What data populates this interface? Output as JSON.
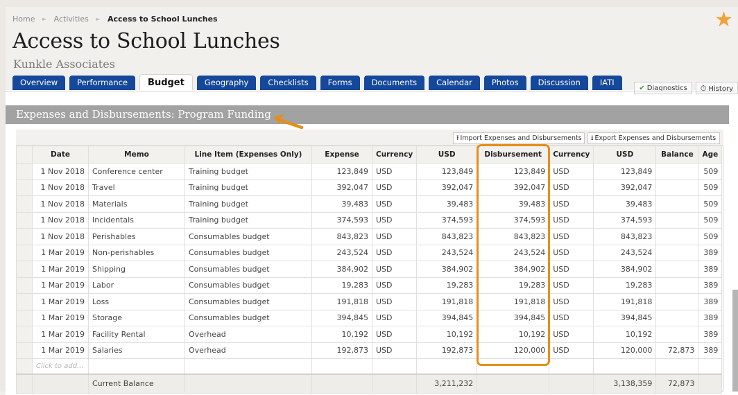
{
  "breadcrumb": [
    "Home",
    "Activities",
    "Access to School Lunches"
  ],
  "page": {
    "title": "Access to School Lunches",
    "organization": "Kunkle Associates"
  },
  "tabs": [
    {
      "label": "Overview",
      "active": false
    },
    {
      "label": "Performance",
      "active": false
    },
    {
      "label": "Budget",
      "active": true
    },
    {
      "label": "Geography",
      "active": false
    },
    {
      "label": "Checklists",
      "active": false
    },
    {
      "label": "Forms",
      "active": false
    },
    {
      "label": "Documents",
      "active": false
    },
    {
      "label": "Calendar",
      "active": false
    },
    {
      "label": "Photos",
      "active": false
    },
    {
      "label": "Discussion",
      "active": false
    },
    {
      "label": "IATI",
      "active": false
    }
  ],
  "side_tools": {
    "diagnostics_label": "Diagnostics",
    "history_label": "History"
  },
  "section": {
    "title": "Expenses and Disbursements: Program Funding"
  },
  "toolbar": {
    "import_label": "Import Expenses and Disbursements",
    "export_label": "Export Expenses and Disbursements"
  },
  "table": {
    "columns": [
      "",
      "Date",
      "Memo",
      "Line Item (Expenses Only)",
      "Expense",
      "Currency",
      "USD",
      "Disbursement",
      "Currency",
      "USD",
      "Balance",
      "Age"
    ],
    "rows": [
      {
        "date": "1 Nov 2018",
        "memo": "Conference center",
        "line_item": "Training budget",
        "expense": "123,849",
        "currency": "USD",
        "usd": "123,849",
        "disbursement": "123,849",
        "currency2": "USD",
        "usd2": "123,849",
        "balance": "",
        "age": "509"
      },
      {
        "date": "1 Nov 2018",
        "memo": "Travel",
        "line_item": "Training budget",
        "expense": "392,047",
        "currency": "USD",
        "usd": "392,047",
        "disbursement": "392,047",
        "currency2": "USD",
        "usd2": "392,047",
        "balance": "",
        "age": "509"
      },
      {
        "date": "1 Nov 2018",
        "memo": "Materials",
        "line_item": "Training budget",
        "expense": "39,483",
        "currency": "USD",
        "usd": "39,483",
        "disbursement": "39,483",
        "currency2": "USD",
        "usd2": "39,483",
        "balance": "",
        "age": "509"
      },
      {
        "date": "1 Nov 2018",
        "memo": "Incidentals",
        "line_item": "Training budget",
        "expense": "374,593",
        "currency": "USD",
        "usd": "374,593",
        "disbursement": "374,593",
        "currency2": "USD",
        "usd2": "374,593",
        "balance": "",
        "age": "509"
      },
      {
        "date": "1 Nov 2018",
        "memo": "Perishables",
        "line_item": "Consumables budget",
        "expense": "843,823",
        "currency": "USD",
        "usd": "843,823",
        "disbursement": "843,823",
        "currency2": "USD",
        "usd2": "843,823",
        "balance": "",
        "age": "509"
      },
      {
        "date": "1 Mar 2019",
        "memo": "Non-perishables",
        "line_item": "Consumables budget",
        "expense": "243,524",
        "currency": "USD",
        "usd": "243,524",
        "disbursement": "243,524",
        "currency2": "USD",
        "usd2": "243,524",
        "balance": "",
        "age": "389"
      },
      {
        "date": "1 Mar 2019",
        "memo": "Shipping",
        "line_item": "Consumables budget",
        "expense": "384,902",
        "currency": "USD",
        "usd": "384,902",
        "disbursement": "384,902",
        "currency2": "USD",
        "usd2": "384,902",
        "balance": "",
        "age": "389"
      },
      {
        "date": "1 Mar 2019",
        "memo": "Labor",
        "line_item": "Consumables budget",
        "expense": "19,283",
        "currency": "USD",
        "usd": "19,283",
        "disbursement": "19,283",
        "currency2": "USD",
        "usd2": "19,283",
        "balance": "",
        "age": "389"
      },
      {
        "date": "1 Mar 2019",
        "memo": "Loss",
        "line_item": "Consumables budget",
        "expense": "191,818",
        "currency": "USD",
        "usd": "191,818",
        "disbursement": "191,818",
        "currency2": "USD",
        "usd2": "191,818",
        "balance": "",
        "age": "389"
      },
      {
        "date": "1 Mar 2019",
        "memo": "Storage",
        "line_item": "Consumables budget",
        "expense": "394,845",
        "currency": "USD",
        "usd": "394,845",
        "disbursement": "394,845",
        "currency2": "USD",
        "usd2": "394,845",
        "balance": "",
        "age": "389"
      },
      {
        "date": "1 Mar 2019",
        "memo": "Facility Rental",
        "line_item": "Overhead",
        "expense": "10,192",
        "currency": "USD",
        "usd": "10,192",
        "disbursement": "10,192",
        "currency2": "USD",
        "usd2": "10,192",
        "balance": "",
        "age": "389"
      },
      {
        "date": "1 Mar 2019",
        "memo": "Salaries",
        "line_item": "Overhead",
        "expense": "192,873",
        "currency": "USD",
        "usd": "192,873",
        "disbursement": "120,000",
        "currency2": "USD",
        "usd2": "120,000",
        "balance": "72,873",
        "age": "389"
      }
    ],
    "add_placeholder": "Click to add...",
    "summary": {
      "label": "Current Balance",
      "usd_total": "3,211,232",
      "usd2_total": "3,138,359",
      "balance_total": "72,873"
    }
  },
  "colors": {
    "tab_blue": "#15489a",
    "accent_orange": "#e58e1b",
    "star_orange": "#f0a23a",
    "section_grey": "#a2a2a2"
  },
  "icons": {
    "star": "star-icon",
    "diagnostics": "check-icon",
    "history": "history-icon",
    "import": "upload-icon",
    "export": "download-icon"
  }
}
